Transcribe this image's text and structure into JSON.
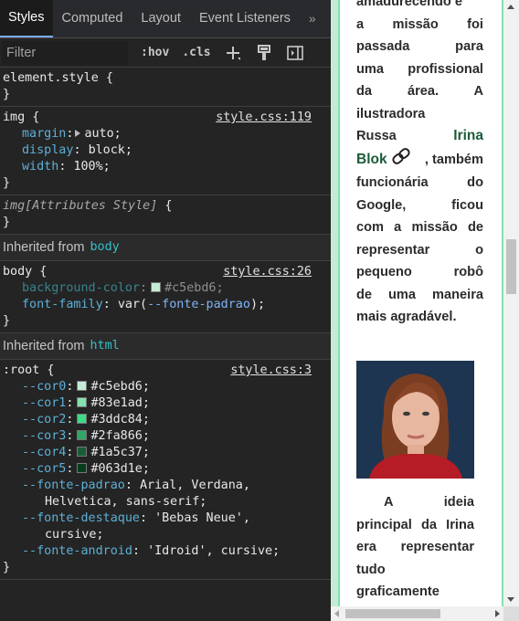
{
  "devtools": {
    "tabs": [
      "Styles",
      "Computed",
      "Layout",
      "Event Listeners",
      "»"
    ],
    "active_tab": "Styles",
    "filter": {
      "placeholder": "Filter",
      "value": ""
    },
    "filter_buttons": {
      "hov": ":hov",
      "cls": ".cls"
    },
    "rules": {
      "element_style": {
        "selector": "element.style {",
        "close": "}"
      },
      "img": {
        "selector": "img {",
        "source": "style.css:119",
        "declarations": [
          {
            "prop": "margin",
            "value": "auto;"
          },
          {
            "prop": "display",
            "value": "block;"
          },
          {
            "prop": "width",
            "value": "100%;"
          }
        ],
        "close": "}"
      },
      "img_attr": {
        "selector": "img[Attributes Style]",
        "open": " {",
        "close": "}"
      },
      "inherited_body": {
        "label": "Inherited from",
        "tag": "body"
      },
      "body": {
        "selector": "body {",
        "source": "style.css:26",
        "bg_prop": "background-color",
        "bg_value": "#c5ebd6;",
        "font_prop": "font-family",
        "font_value_pre": "var(",
        "font_value_var": "--fonte-padrao",
        "font_value_post": ");",
        "close": "}"
      },
      "inherited_html": {
        "label": "Inherited from",
        "tag": "html"
      },
      "root": {
        "selector": ":root {",
        "source": "style.css:3",
        "colors": [
          {
            "prop": "--cor0",
            "value": "#c5ebd6;",
            "swatch": "#c5ebd6"
          },
          {
            "prop": "--cor1",
            "value": "#83e1ad;",
            "swatch": "#83e1ad"
          },
          {
            "prop": "--cor2",
            "value": "#3ddc84;",
            "swatch": "#3ddc84"
          },
          {
            "prop": "--cor3",
            "value": "#2fa866;",
            "swatch": "#2fa866"
          },
          {
            "prop": "--cor4",
            "value": "#1a5c37;",
            "swatch": "#1a5c37"
          },
          {
            "prop": "--cor5",
            "value": "#063d1e;",
            "swatch": "#063d1e"
          }
        ],
        "fonte_padrao_prop": "--fonte-padrao",
        "fonte_padrao_value_1": "Arial, Verdana,",
        "fonte_padrao_value_2": "Helvetica, sans-serif;",
        "fonte_destaque_prop": "--fonte-destaque",
        "fonte_destaque_value_1": "'Bebas Neue',",
        "fonte_destaque_value_2": "cursive;",
        "fonte_android_prop": "--fonte-android",
        "fonte_android_value": "'Idroid', cursive;",
        "close": "}"
      }
    }
  },
  "preview": {
    "paragraph1_lines": [
      "amadurecendo e",
      "a missão foi",
      "passada para",
      "uma profissional",
      "da área. A",
      "ilustradora"
    ],
    "paragraph1_before_name": "Russa",
    "name": "Irina Blok",
    "paragraph1_after_name_lines": [
      ", também",
      "funcionária do",
      "Google, ficou",
      "com a missão de",
      "representar o",
      "pequeno robô",
      "de uma maneira",
      "mais agradável."
    ],
    "paragraph2_lines": [
      "A ideia",
      "principal da Irina",
      "era representar",
      "tudo",
      "graficamente"
    ]
  }
}
